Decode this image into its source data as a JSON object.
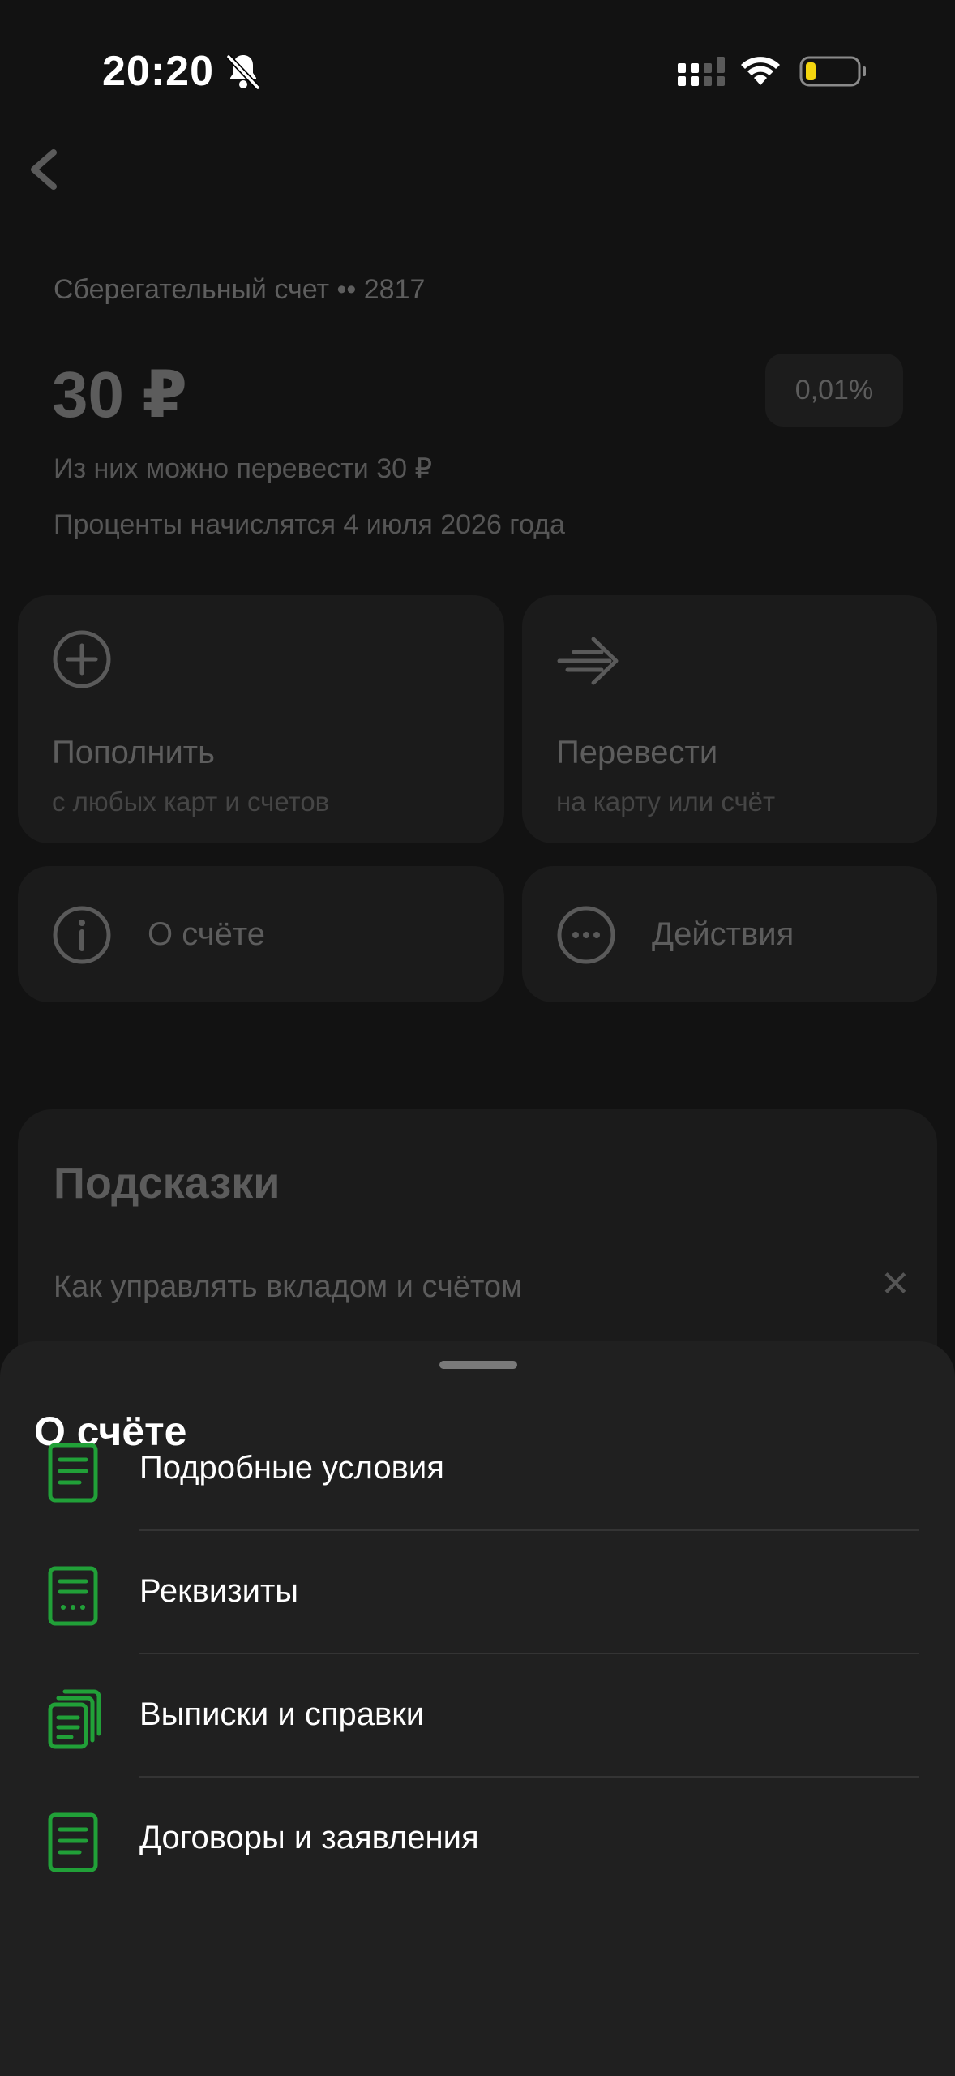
{
  "status_bar": {
    "time": "20:20"
  },
  "account": {
    "title": "Сберегательный счет •• 2817",
    "balance": "30 ₽",
    "rate": "0,01%",
    "available": "Из них можно перевести 30 ₽",
    "interest": "Проценты начислятся 4 июля 2026 года"
  },
  "actions": {
    "topup": {
      "title": "Пополнить",
      "subtitle": "с любых карт и счетов"
    },
    "transfer": {
      "title": "Перевести",
      "subtitle": "на карту или счёт"
    },
    "about": {
      "title": "О счёте"
    },
    "more": {
      "title": "Действия"
    }
  },
  "tips": {
    "title": "Подсказки",
    "item": "Как управлять вкладом и счётом",
    "close": "✕"
  },
  "sheet": {
    "title": "О счёте",
    "items": [
      {
        "label": "Подробные условия",
        "icon": "document-icon"
      },
      {
        "label": "Реквизиты",
        "icon": "requisites-icon"
      },
      {
        "label": "Выписки и справки",
        "icon": "documents-stack-icon"
      },
      {
        "label": "Договоры и заявления",
        "icon": "document-icon"
      }
    ]
  },
  "colors": {
    "accent": "#21A038",
    "sheet_bg": "#202020",
    "battery_low": "#F4D60F"
  }
}
